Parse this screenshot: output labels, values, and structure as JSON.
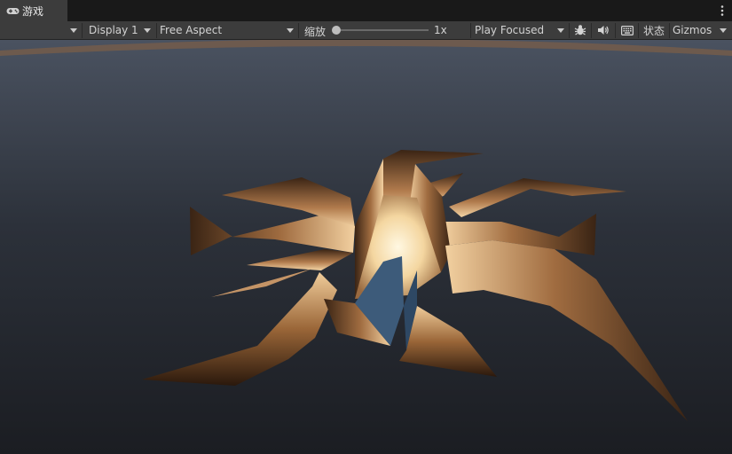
{
  "tab": {
    "label": "游戏",
    "icon": "gamepad-icon"
  },
  "menu_icon": "kebab-menu-icon",
  "toolbar": {
    "mode_dropdown_value": "",
    "display": "Display 1",
    "aspect": "Free Aspect",
    "scale_label": "缩放",
    "scale_value": "1x",
    "scale_level": 0,
    "play_mode": "Play Focused",
    "status_label": "状态",
    "gizmos_label": "Gizmos",
    "icons": [
      "bug-icon",
      "speaker-icon",
      "keyboard-icon",
      "chevron-down-icon"
    ]
  },
  "colors": {
    "tab_active": "#3c3c3c",
    "toolbar_bg": "#3c3c3c",
    "tab_bar_bg": "#191919",
    "sky_top": "#4a5260",
    "sky_bottom": "#1b1d22",
    "crack_light": "#fff6d8",
    "crack_mid": "#c08a5a",
    "crack_dark": "#3a2414",
    "horizon_glow": "#8a6a4e"
  }
}
